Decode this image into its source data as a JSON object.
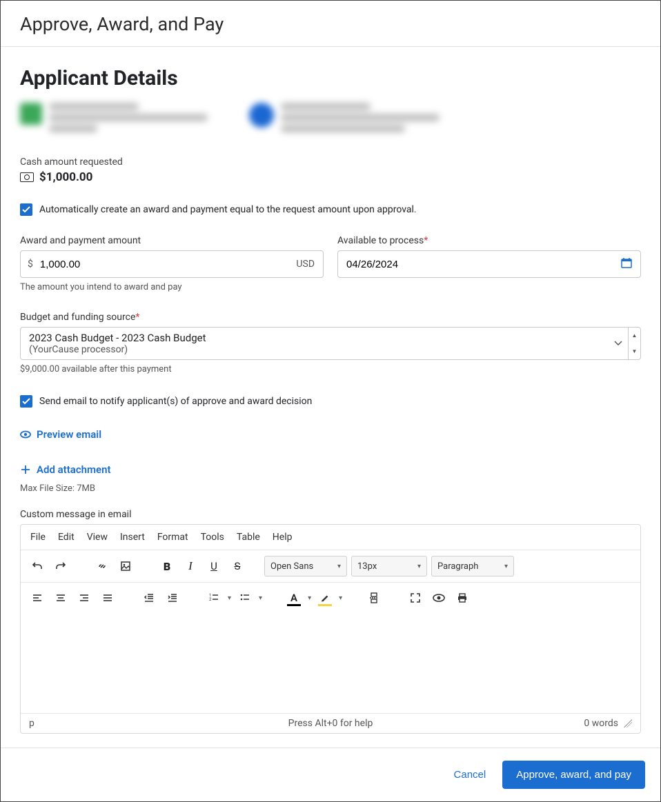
{
  "modal": {
    "title": "Approve, Award, and Pay"
  },
  "heading": "Applicant Details",
  "cash": {
    "label": "Cash amount requested",
    "value": "$1,000.00"
  },
  "auto_create": {
    "label": "Automatically create an award and payment equal to the request amount upon approval."
  },
  "award_amount": {
    "label": "Award and payment amount",
    "prefix": "$",
    "value": "1,000.00",
    "suffix": "USD",
    "hint": "The amount you intend to award and pay"
  },
  "available_date": {
    "label": "Available to process",
    "required": "*",
    "value": "04/26/2024"
  },
  "budget": {
    "label": "Budget and funding source",
    "required": "*",
    "line1": "2023 Cash Budget - 2023 Cash Budget",
    "line2": "(YourCause processor)",
    "hint": "$9,000.00 available after this payment"
  },
  "notify": {
    "label": "Send email to notify applicant(s) of approve and award decision"
  },
  "preview_email": "Preview email",
  "add_attachment": "Add attachment",
  "max_file": "Max File Size: 7MB",
  "custom_msg_label": "Custom message in email",
  "editor": {
    "menus": {
      "file": "File",
      "edit": "Edit",
      "view": "View",
      "insert": "Insert",
      "format": "Format",
      "tools": "Tools",
      "table": "Table",
      "help": "Help"
    },
    "font": "Open Sans",
    "size": "13px",
    "paragraph": "Paragraph",
    "status_path": "p",
    "status_help": "Press Alt+0 for help",
    "words": "0 words"
  },
  "footer": {
    "cancel": "Cancel",
    "primary": "Approve, award, and pay"
  }
}
